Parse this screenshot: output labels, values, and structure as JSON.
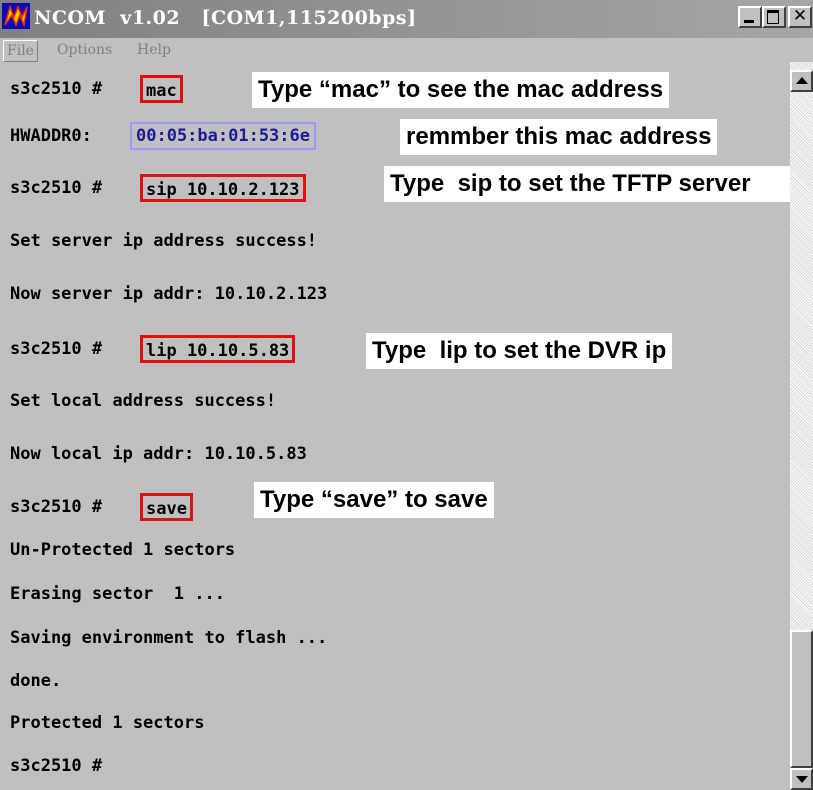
{
  "window": {
    "title": "NCOM  v1.02   [COM1,115200bps]",
    "icon": "ncom-app-icon",
    "buttons": {
      "minimize": "minimize-icon",
      "maximize": "maximize-icon",
      "close": "✕"
    }
  },
  "menu": {
    "file": "File",
    "options": "Options",
    "help": "Help"
  },
  "terminal": {
    "prompt": "s3c2510 #",
    "cmd_mac": "mac",
    "hwaddr_label": "HWADDR0:",
    "hwaddr_value": "00:05:ba:01:53:6e",
    "cmd_sip": "sip 10.10.2.123",
    "set_server": "Set server ip address success!",
    "now_server": "Now server ip addr: 10.10.2.123",
    "cmd_lip": "lip 10.10.5.83",
    "set_local": "Set local address success!",
    "now_local": "Now local ip addr: 10.10.5.83",
    "cmd_save": "save",
    "unprotected": "Un-Protected 1 sectors",
    "erasing": "Erasing sector  1 ...",
    "saving": "Saving environment to flash ...",
    "done": "done.",
    "protected": "Protected 1 sectors"
  },
  "annotations": {
    "mac_note": "Type “mac” to see the mac address",
    "remember_note": "remmber this mac address",
    "sip_note": "Type  sip to set the TFTP server",
    "lip_note": "Type  lip to set the DVR ip",
    "save_note": "Type “save” to save"
  },
  "colors": {
    "highlight_box": "#e01010",
    "mac_box": "#9999ff",
    "background": "#c0c0c0"
  }
}
